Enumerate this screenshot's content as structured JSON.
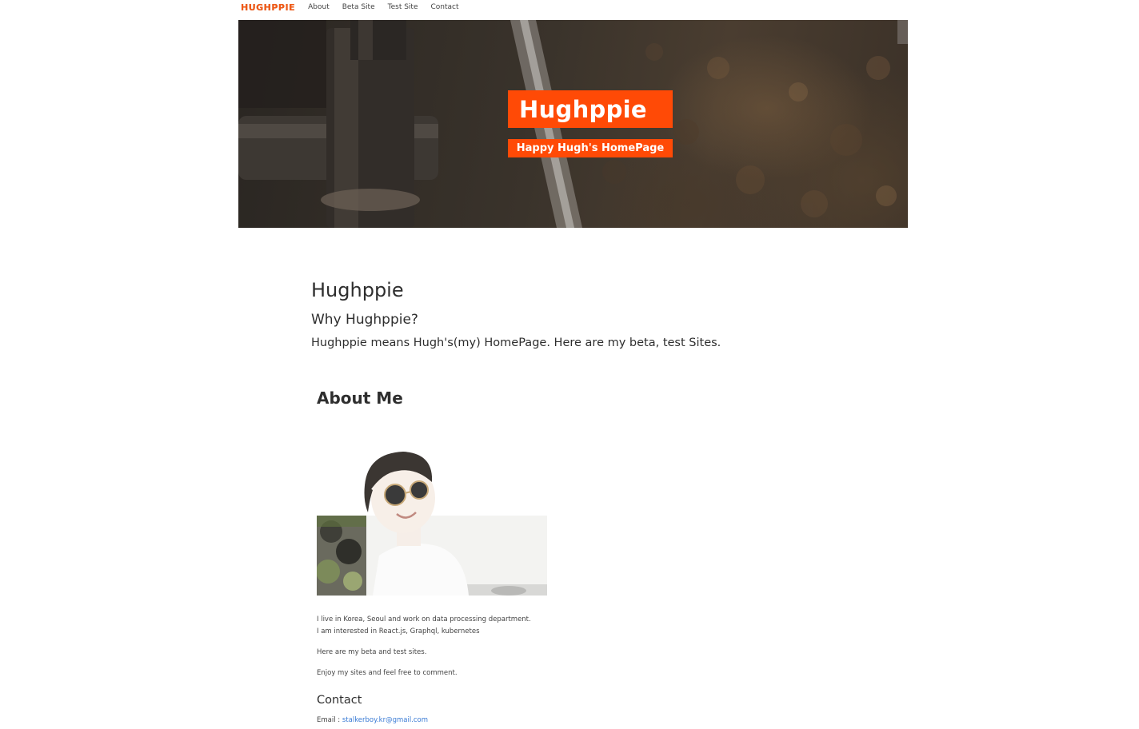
{
  "navbar": {
    "brand": "HUGHPPIE",
    "links": [
      "About",
      "Beta Site",
      "Test Site",
      "Contact"
    ]
  },
  "hero": {
    "title": "Hughppie",
    "subtitle": "Happy Hugh's HomePage"
  },
  "intro": {
    "title": "Hughppie",
    "subtitle": "Why Hughppie?",
    "text": "Hughppie means Hugh's(my) HomePage. Here are my beta, test Sites."
  },
  "about": {
    "heading": "About Me",
    "bio_line1": "I live in Korea, Seoul and work on data processing department.",
    "bio_line2": "I am interested in React.js, Graphql, kubernetes",
    "bio_line3": "Here are my beta and test sites.",
    "bio_line4": "Enjoy my sites and feel free to comment."
  },
  "contact": {
    "heading": "Contact",
    "email_label": "Email : ",
    "email": "stalkerboy.kr@gmail.com"
  },
  "colors": {
    "accent": "#ff4a06",
    "brand": "#f05a17",
    "link": "#3a7bd5"
  }
}
